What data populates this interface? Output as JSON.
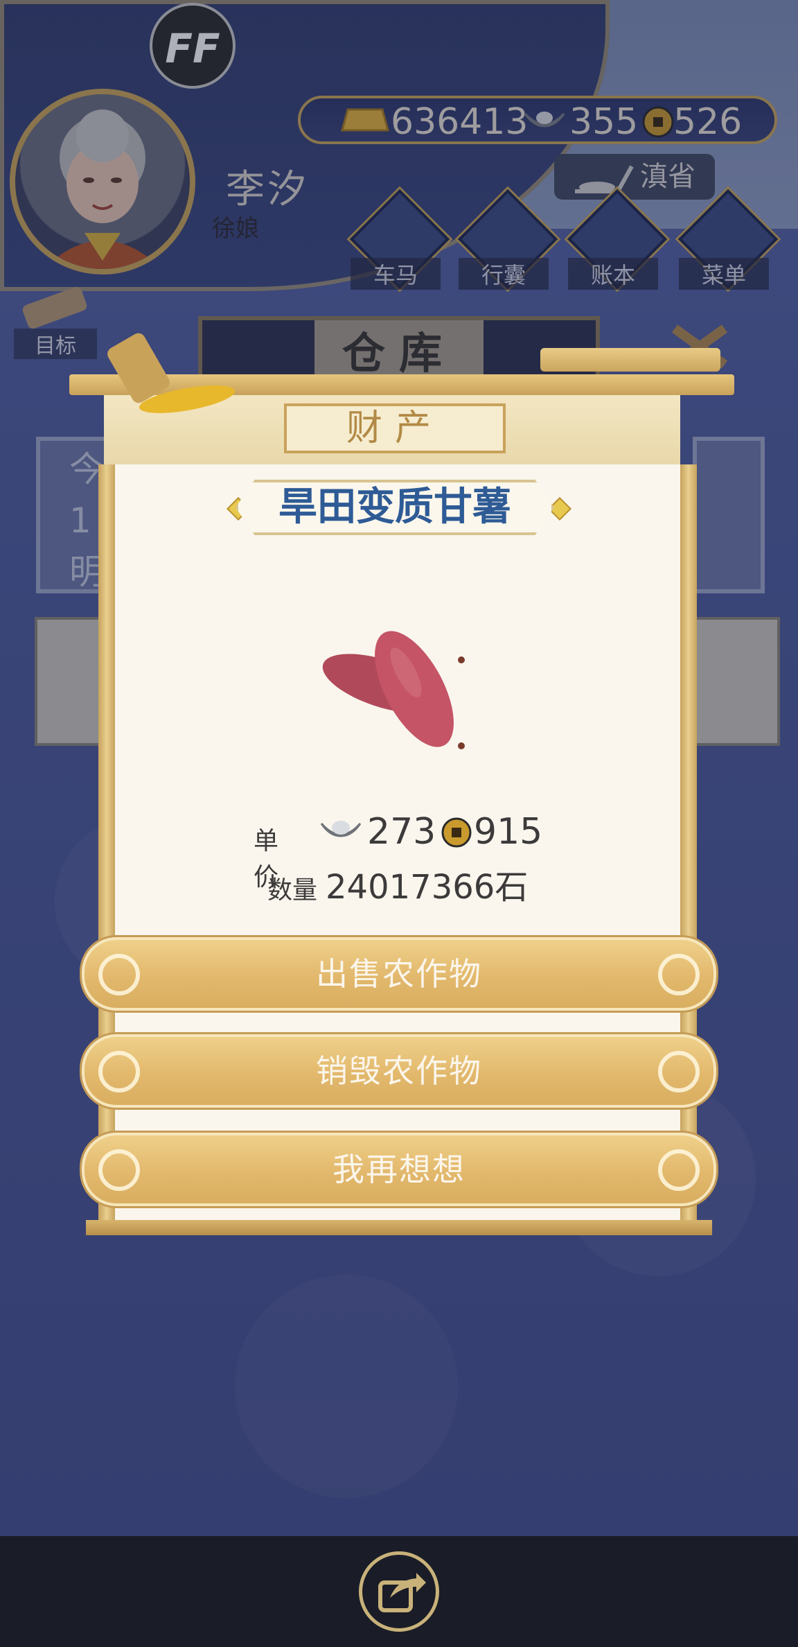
{
  "player": {
    "badge": "FF",
    "name": "李汐",
    "title": "徐娘"
  },
  "currency": {
    "gold": "636413",
    "silver": "355",
    "coin": "526"
  },
  "province": "滇省",
  "nav": [
    {
      "label": "车马",
      "icon": "carriage-icon"
    },
    {
      "label": "行囊",
      "icon": "bag-icon"
    },
    {
      "label": "账本",
      "icon": "ledger-icon"
    },
    {
      "label": "菜单",
      "icon": "menu-dots-icon"
    }
  ],
  "goal_label": "目标",
  "background": {
    "warehouse_title": "仓库",
    "text_line1": "今",
    "text_line2": "1",
    "text_line3": "明"
  },
  "dialog": {
    "category": "财产",
    "item_name": "旱田变质甘薯",
    "price_label": "单价",
    "price_silver": "273",
    "price_coin": "915",
    "quantity_label": "数量",
    "quantity": "24017366石",
    "buttons": {
      "sell": "出售农作物",
      "destroy": "销毁农作物",
      "cancel": "我再想想"
    }
  },
  "colors": {
    "item_name": "#2e5b96",
    "gold_trim": "#c9a25a",
    "button": "#e2b86c"
  }
}
